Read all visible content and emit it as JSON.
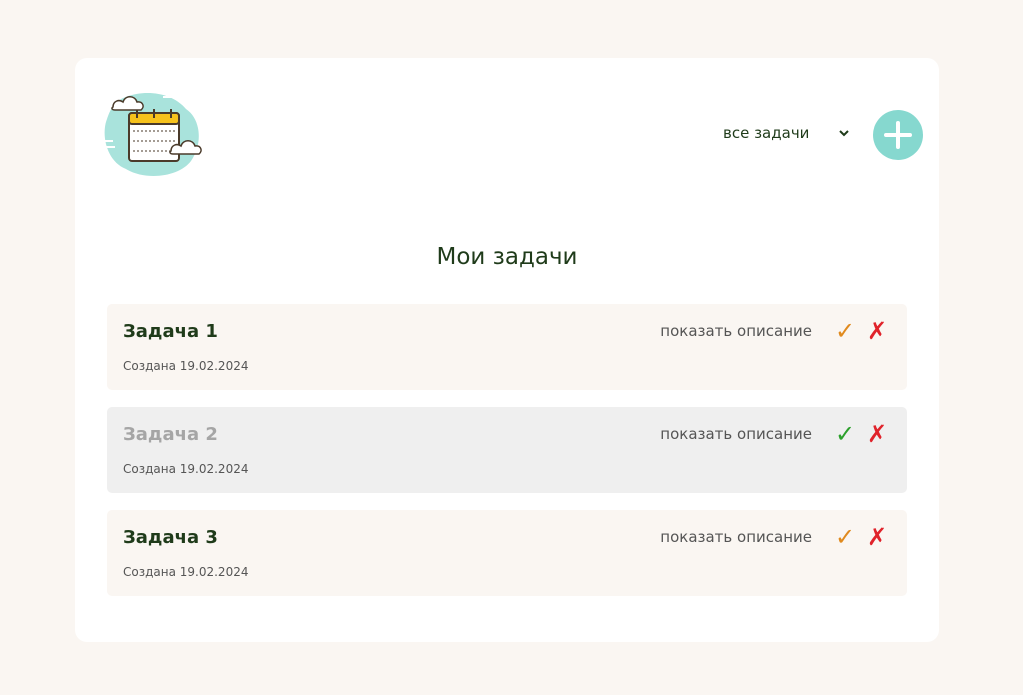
{
  "header": {
    "filter_label": "все задачи",
    "add_button_icon": "plus-icon",
    "logo_icon": "calendar-clouds-icon"
  },
  "main": {
    "title": "Мои задачи"
  },
  "tasks": [
    {
      "title": "Задача 1",
      "created": "Создана 19.02.2024",
      "show_label": "показать описание",
      "check_glyph": "✓",
      "delete_glyph": "✗",
      "completed": false,
      "check_color": "#e08a1e"
    },
    {
      "title": "Задача 2",
      "created": "Создана 19.02.2024",
      "show_label": "показать описание",
      "check_glyph": "✓",
      "delete_glyph": "✗",
      "completed": true,
      "check_color": "#2ca02c"
    },
    {
      "title": "Задача 3",
      "created": "Создана 19.02.2024",
      "show_label": "показать описание",
      "check_glyph": "✓",
      "delete_glyph": "✗",
      "completed": false,
      "check_color": "#e08a1e"
    }
  ],
  "colors": {
    "background": "#faf6f2",
    "card": "#ffffff",
    "accent": "#86d8cf",
    "text_dark": "#1f3b1a",
    "delete_red": "#e0232b",
    "pending_check": "#e08a1e",
    "done_check": "#2ca02c"
  }
}
